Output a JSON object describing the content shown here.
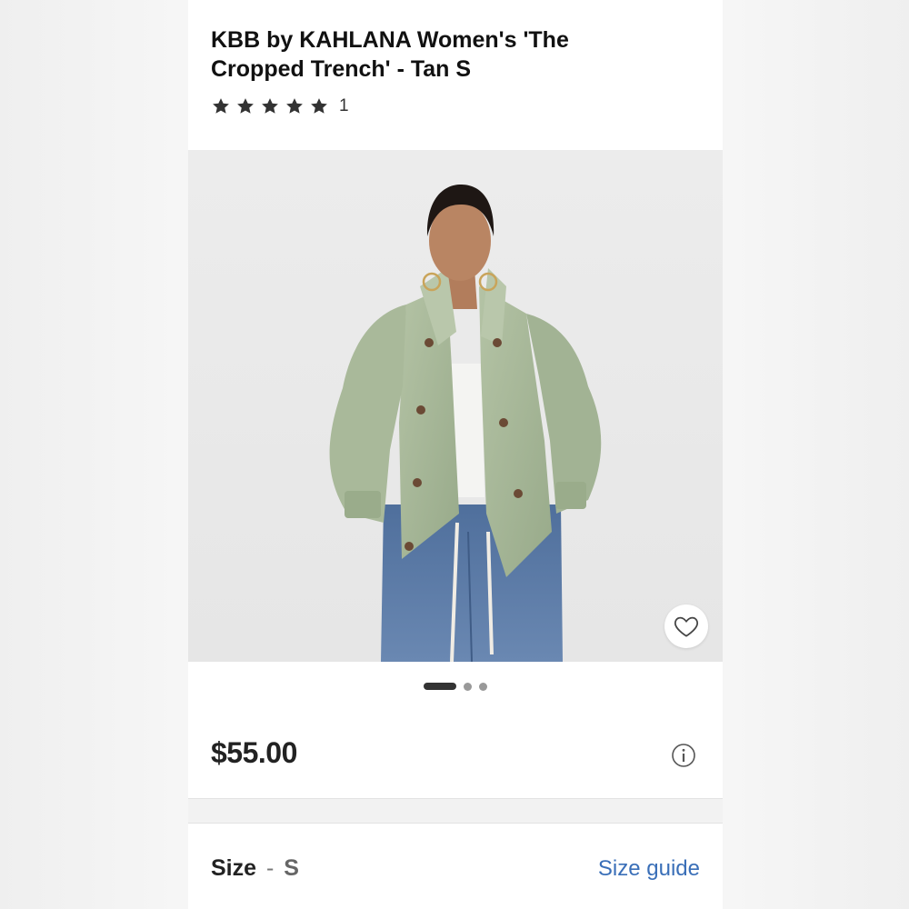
{
  "product": {
    "title": "KBB by KAHLANA Women's 'The Cropped Trench' - Tan S",
    "rating": {
      "stars": 5,
      "max_stars": 5,
      "count": "1"
    },
    "carousel": {
      "total_images": 3,
      "active_index": 0
    },
    "price": "$55.00",
    "size": {
      "label": "Size",
      "separator": "-",
      "value": "S",
      "guide_link": "Size guide"
    }
  },
  "icons": {
    "star": "star-icon",
    "favorite": "heart-outline-icon",
    "info": "info-circle-icon"
  },
  "colors": {
    "link": "#3a6fb8",
    "text": "#111111",
    "jacket": "#a7b89a",
    "jeans": "#5a7aa6"
  }
}
